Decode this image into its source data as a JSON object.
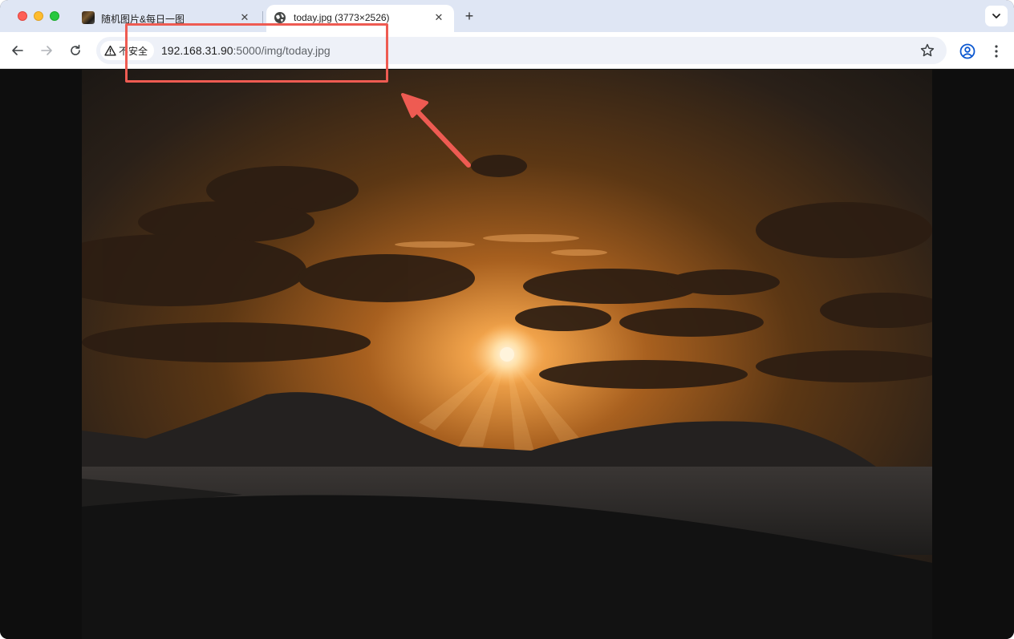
{
  "browser": {
    "tabs": [
      {
        "title": "随机图片&每日一图",
        "active": false,
        "close_label": "✕"
      },
      {
        "title": "today.jpg (3773×2526)",
        "active": true,
        "close_label": "✕"
      }
    ],
    "new_tab_label": "+",
    "security_label": "不安全",
    "url_host": "192.168.31.90",
    "url_rest": ":5000/img/today.jpg"
  },
  "colors": {
    "tabstrip": "#dfe6f4",
    "omnibox": "#eef1f8",
    "annotation": "#ee5b52",
    "page_background": "#0e0e0e"
  },
  "icons": {
    "back": "arrow-left-icon",
    "forward": "arrow-right-icon",
    "reload": "reload-icon",
    "warning": "warning-triangle-icon",
    "bookmark": "star-icon",
    "profile": "profile-icon",
    "menu": "kebab-menu-icon",
    "tab_search": "chevron-down-icon"
  }
}
